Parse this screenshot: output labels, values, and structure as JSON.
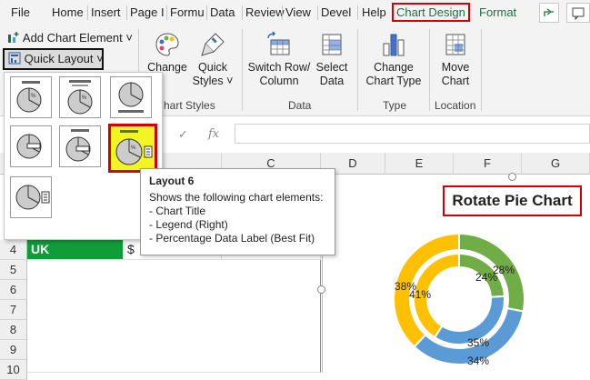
{
  "tabs": [
    "File",
    "Home",
    "Insert",
    "Page I",
    "Formu",
    "Data",
    "Review",
    "View",
    "Devel",
    "Help",
    "Chart Design",
    "Format"
  ],
  "ribbon": {
    "add_chart_element": "Add Chart Element ˅",
    "quick_layout": "Quick Layout ˅",
    "change_colors_1": "Change",
    "change_colors_2": "",
    "quick_styles_1": "Quick",
    "quick_styles_2": "Styles ˅",
    "chart_styles_group": "hart Styles",
    "switch_row_1": "Switch Row/",
    "switch_row_2": "Column",
    "select_data_1": "Select",
    "select_data_2": "Data",
    "data_group": "Data",
    "change_type_1": "Change",
    "change_type_2": "Chart Type",
    "type_group": "Type",
    "move_chart_1": "Move",
    "move_chart_2": "Chart",
    "location_group": "Location"
  },
  "formula_bar": {
    "fx": "fx",
    "check": "✓"
  },
  "columns": [
    "C",
    "D",
    "E",
    "F",
    "G"
  ],
  "rows": [
    "4",
    "5",
    "6",
    "7",
    "8",
    "9",
    "10"
  ],
  "cells": {
    "uk_label": "UK",
    "currency": "$"
  },
  "gallery": {
    "selected_index": 5,
    "count": 7
  },
  "tooltip": {
    "title": "Layout 6",
    "subtitle": "Shows the following chart elements:",
    "items": [
      "- Chart Title",
      "- Legend (Right)",
      "- Percentage Data Label (Best Fit)"
    ]
  },
  "chart_data": {
    "type": "donut",
    "title": "Rotate Pie Chart",
    "colors": [
      "#70ad47",
      "#5b9bd5",
      "#ffc000"
    ],
    "rings": [
      {
        "labels": [
          "28%",
          "34%",
          "38%"
        ],
        "values": [
          28,
          34,
          38
        ]
      },
      {
        "labels": [
          "24%",
          "35%",
          "41%"
        ],
        "values": [
          24,
          35,
          41
        ]
      }
    ]
  }
}
